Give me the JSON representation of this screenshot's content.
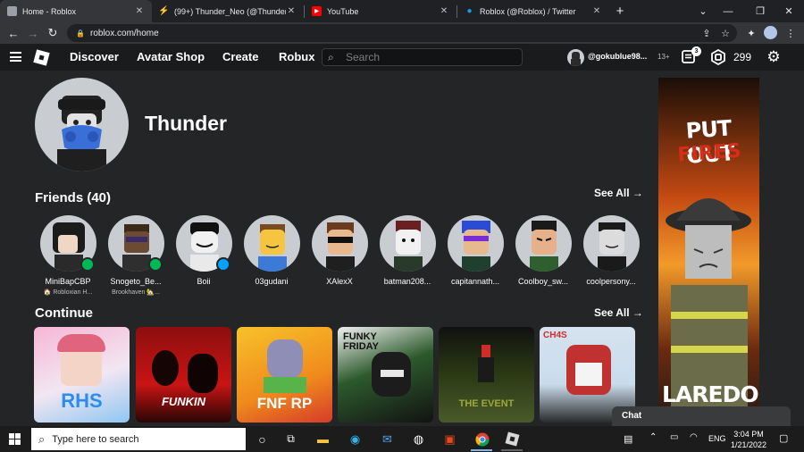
{
  "browser": {
    "tabs": [
      {
        "title": "Home - Roblox",
        "favicon_color": "#9aa0a6",
        "active": true
      },
      {
        "title": "(99+) Thunder_Neo (@Thunder_",
        "favicon_color": "#1de9b6",
        "active": false
      },
      {
        "title": "YouTube",
        "favicon_color": "#ff0000",
        "active": false
      },
      {
        "title": "Roblox (@Roblox) / Twitter",
        "favicon_color": "#1d9bf0",
        "active": false
      }
    ],
    "url": "roblox.com/home"
  },
  "header": {
    "nav": [
      "Discover",
      "Avatar Shop",
      "Create",
      "Robux"
    ],
    "search_placeholder": "Search",
    "username": "@gokublue98...",
    "age": "13+",
    "notifications": "3",
    "robux": "299"
  },
  "profile": {
    "name": "Thunder"
  },
  "friends": {
    "title": "Friends (40)",
    "see_all": "See All →",
    "items": [
      {
        "name": "MiniBapCBP",
        "game": "🏠 Robloxian H...",
        "status": "game"
      },
      {
        "name": "Snogeto_Be...",
        "game": "Brookhaven 🏡...",
        "status": "game"
      },
      {
        "name": "Boii",
        "game": "",
        "status": "online"
      },
      {
        "name": "03gudani",
        "game": "",
        "status": ""
      },
      {
        "name": "XAlexX",
        "game": "",
        "status": ""
      },
      {
        "name": "batman208...",
        "game": "",
        "status": ""
      },
      {
        "name": "capitannath...",
        "game": "",
        "status": ""
      },
      {
        "name": "Coolboy_sw...",
        "game": "",
        "status": ""
      },
      {
        "name": "coolpersony...",
        "game": "",
        "status": ""
      }
    ]
  },
  "continue": {
    "title": "Continue",
    "see_all": "See All →",
    "games": [
      {
        "label": "RHS",
        "name": "rhs-game"
      },
      {
        "label": "FUNKIN",
        "name": "fnf-game"
      },
      {
        "label": "FNF RP",
        "name": "fnf-rp-game"
      },
      {
        "label": "FUNKY FRIDAY",
        "name": "funky-friday-game"
      },
      {
        "label": "THE EVENT",
        "name": "the-event-game"
      },
      {
        "label": "CH4S",
        "name": "ch4s-game"
      }
    ]
  },
  "ad": {
    "line1": "PUT OUT",
    "line2": "FIRES",
    "line3": "LAREDO"
  },
  "chat": {
    "label": "Chat"
  },
  "taskbar": {
    "search_placeholder": "Type here to search",
    "language": "ENG",
    "time": "3:04 PM",
    "date": "1/21/2022"
  }
}
